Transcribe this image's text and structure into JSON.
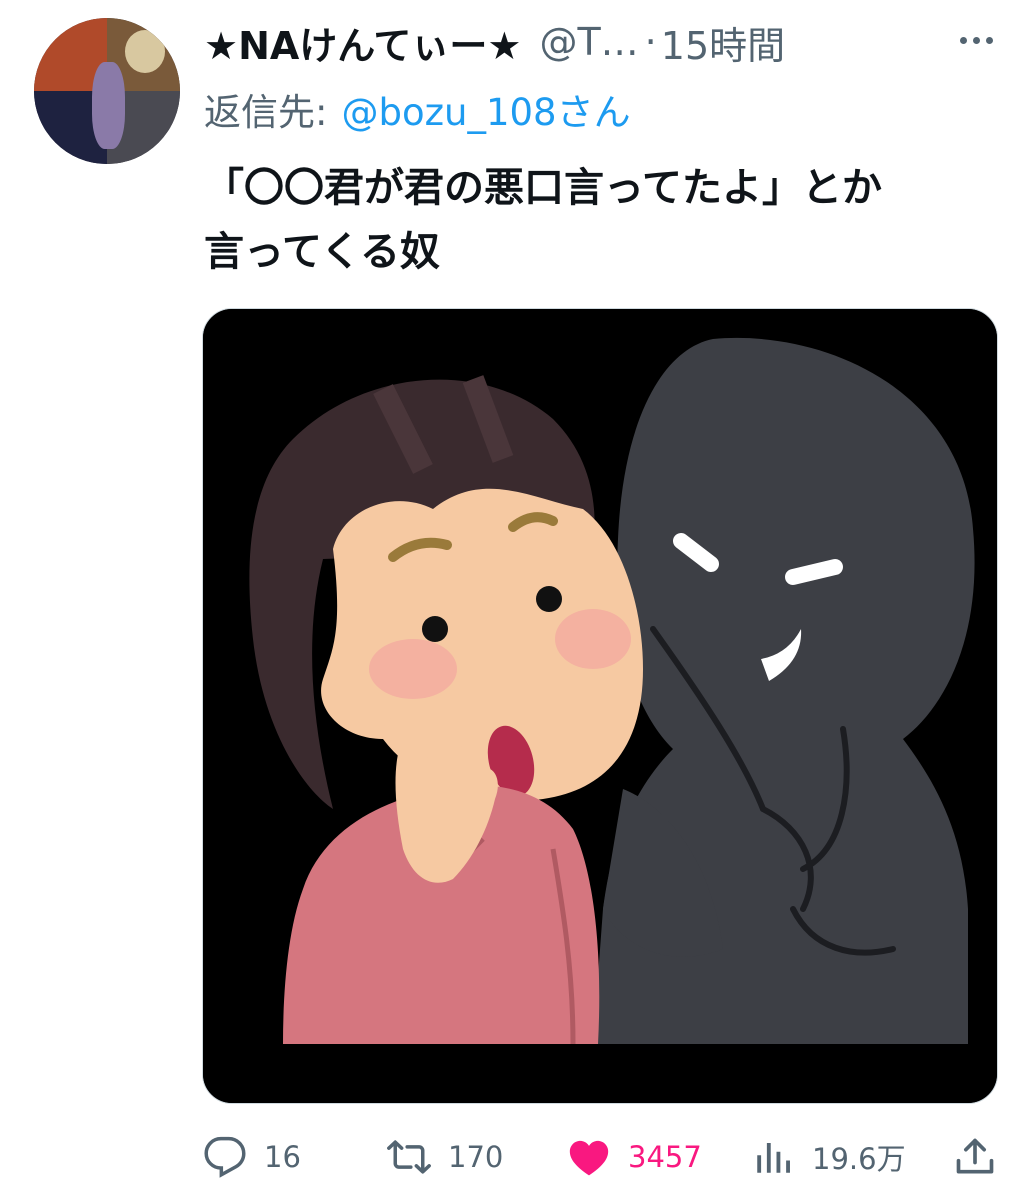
{
  "author": {
    "display_name": "★NAけんてぃー★",
    "handle": "@T…",
    "separator": "·",
    "time": "15時間"
  },
  "reply": {
    "prefix": "返信先:",
    "to": "@bozu_108さん"
  },
  "tweet": {
    "lines": [
      "「〇〇君が君の悪口言ってたよ」とか",
      "言ってくる奴"
    ]
  },
  "media": {
    "description_icon": "illustration-whisper-image"
  },
  "actions": {
    "reply_count": "16",
    "retweet_count": "170",
    "like_count": "3457",
    "views_count": "19.6万",
    "liked": true
  },
  "colors": {
    "text": "#0f1419",
    "secondary": "#536471",
    "link": "#1d9bf0",
    "like": "#f91880"
  },
  "icons": [
    "more-icon",
    "reply-icon",
    "retweet-icon",
    "heart-icon",
    "views-icon",
    "share-icon"
  ]
}
